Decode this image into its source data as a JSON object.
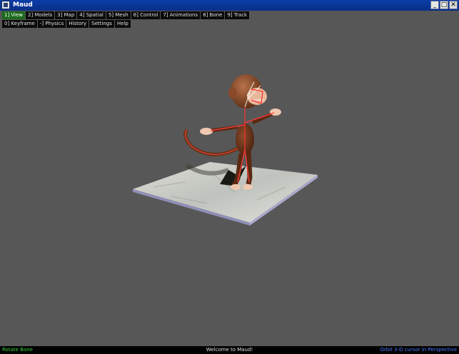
{
  "window": {
    "title": "Maud",
    "buttons": {
      "minimize": "_",
      "maximize": "□",
      "close": "✕"
    }
  },
  "menu_row1": [
    {
      "label": "1] View",
      "active": true
    },
    {
      "label": "2] Models"
    },
    {
      "label": "3] Map"
    },
    {
      "label": "4] Spatial"
    },
    {
      "label": "5] Mesh"
    },
    {
      "label": "6] Control"
    },
    {
      "label": "7] Animations"
    },
    {
      "label": "8] Bone"
    },
    {
      "label": "9] Track"
    }
  ],
  "menu_row2": [
    {
      "label": "0] Keyframe"
    },
    {
      "label": "-] Physics"
    },
    {
      "label": "History"
    },
    {
      "label": "Settings"
    },
    {
      "label": "Help"
    }
  ],
  "status": {
    "left": "Rotate Bone",
    "center": "Welcome to Maud!",
    "right": "Orbit 3-D cursor in Perspective"
  },
  "colors": {
    "viewport_bg": "#575757",
    "active_tab": "#1c6b1c",
    "status_left": "#3fd23f",
    "status_right": "#4f78ff"
  }
}
